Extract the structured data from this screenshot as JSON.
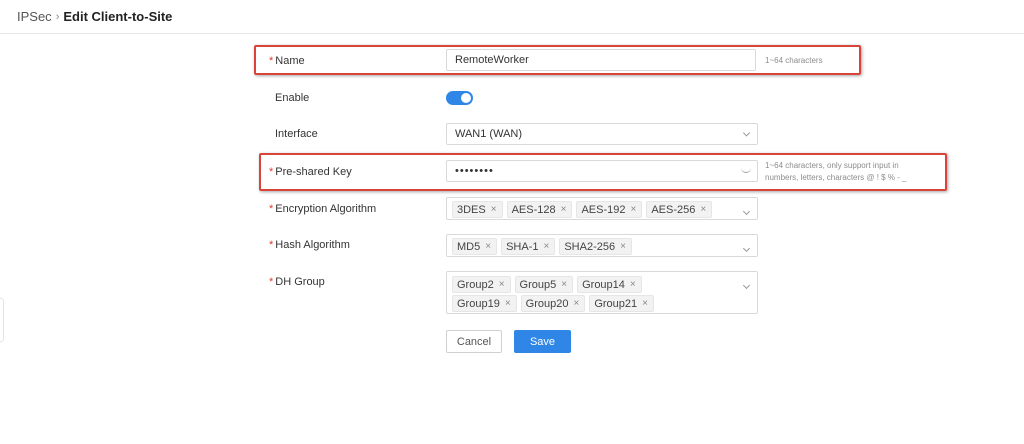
{
  "breadcrumb": {
    "parent": "IPSec",
    "separator": "›",
    "current": "Edit Client-to-Site"
  },
  "form": {
    "name": {
      "label": "Name",
      "required_mark": "*",
      "value": "RemoteWorker",
      "hint": "1~64 characters"
    },
    "enable": {
      "label": "Enable",
      "state": "on"
    },
    "interface": {
      "label": "Interface",
      "value": "WAN1 (WAN)"
    },
    "psk": {
      "label": "Pre-shared Key",
      "required_mark": "*",
      "value": "••••••••",
      "hint_line1": "1~64 characters, only support input in",
      "hint_line2": "numbers, letters, characters @ ! $ % - _"
    },
    "encryption": {
      "label": "Encryption Algorithm",
      "required_mark": "*",
      "tags": [
        "3DES",
        "AES-128",
        "AES-192",
        "AES-256"
      ]
    },
    "hash": {
      "label": "Hash Algorithm",
      "required_mark": "*",
      "tags": [
        "MD5",
        "SHA-1",
        "SHA2-256"
      ]
    },
    "dh": {
      "label": "DH Group",
      "required_mark": "*",
      "tags": [
        "Group2",
        "Group5",
        "Group14",
        "Group19",
        "Group20",
        "Group21"
      ]
    }
  },
  "tag_remove_glyph": "×",
  "buttons": {
    "cancel": "Cancel",
    "save": "Save"
  },
  "colors": {
    "accent": "#2f86e6",
    "highlight": "#d9443a",
    "required": "#e0392c"
  }
}
